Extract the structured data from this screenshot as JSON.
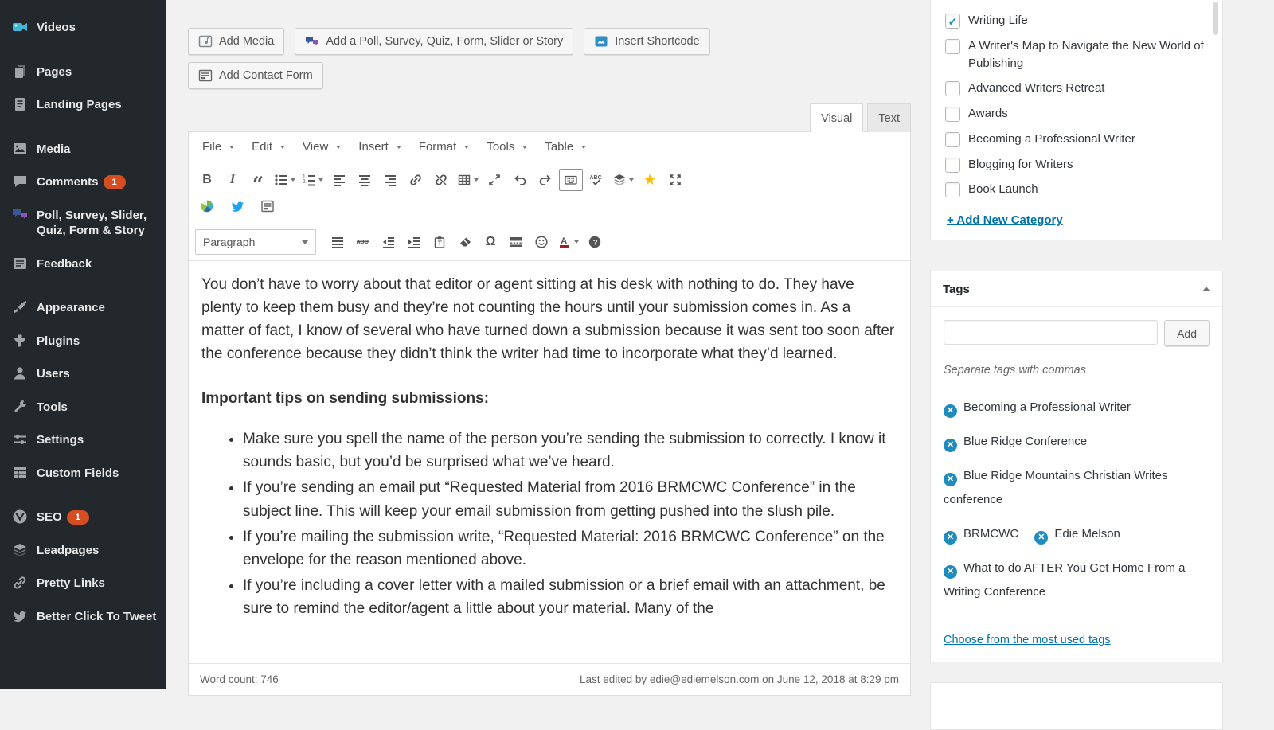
{
  "colors": {
    "accent": "#0073aa",
    "sidebar_bg": "#23282d",
    "badge": "#d54e21",
    "checkbox_check": "#1e8cbe",
    "tag_remove": "#1e8cbe",
    "star": "#ffb900",
    "twitter": "#1da1f2"
  },
  "sidebar": {
    "items": [
      {
        "label": "Videos"
      },
      {
        "label": "Pages"
      },
      {
        "label": "Landing Pages"
      },
      {
        "label": "Media"
      },
      {
        "label": "Comments",
        "badge": "1"
      },
      {
        "label": "Poll, Survey, Slider, Quiz, Form & Story"
      },
      {
        "label": "Feedback"
      },
      {
        "label": "Appearance"
      },
      {
        "label": "Plugins"
      },
      {
        "label": "Users"
      },
      {
        "label": "Tools"
      },
      {
        "label": "Settings"
      },
      {
        "label": "Custom Fields"
      },
      {
        "label": "SEO",
        "badge": "1"
      },
      {
        "label": "Leadpages"
      },
      {
        "label": "Pretty Links"
      },
      {
        "label": "Better Click To Tweet"
      }
    ]
  },
  "actions": {
    "add_media": "Add Media",
    "add_poll": "Add a Poll, Survey, Quiz, Form, Slider or Story",
    "insert_shortcode": "Insert Shortcode",
    "add_contact_form": "Add Contact Form"
  },
  "editor": {
    "tabs": {
      "visual": "Visual",
      "text": "Text"
    },
    "menus": [
      "File",
      "Edit",
      "View",
      "Insert",
      "Format",
      "Tools",
      "Table"
    ],
    "paragraph_dropdown": "Paragraph",
    "content": {
      "paragraph1": "You don’t have to worry about that editor or agent sitting at his desk with nothing to do. They have plenty to keep them busy and they’re not counting the hours until your submission comes in. As a matter of fact, I know of several who have turned down a submission because it was sent too soon after the conference because they didn’t think the writer had time to incorporate what they’d learned.",
      "heading": "Important tips on sending submissions:",
      "bullets": [
        "Make sure you spell the name of the person you’re sending the submission to correctly. I know it sounds basic, but you’d be surprised what we’ve heard.",
        "If you’re sending an email put “Requested Material from 2016 BRMCWC Conference” in the subject line. This will keep your email submission from getting pushed into the slush pile.",
        "If you’re mailing the submission write, “Requested Material: 2016 BRMCWC Conference” on the envelope for the reason mentioned above.",
        "If you’re including a cover letter with a mailed submission or a brief email with an attachment, be sure to remind the editor/agent a little about your material. Many of the"
      ]
    },
    "status": {
      "word_count": "Word count: 746",
      "last_edited": "Last edited by edie@ediemelson.com on June 12, 2018 at 8:29 pm"
    }
  },
  "categories": {
    "items": [
      {
        "label": "Writing Life",
        "checked": true
      },
      {
        "label": "A Writer's Map to Navigate the New World of Publishing",
        "checked": false
      },
      {
        "label": "Advanced Writers Retreat",
        "checked": false
      },
      {
        "label": "Awards",
        "checked": false
      },
      {
        "label": "Becoming a Professional Writer",
        "checked": false
      },
      {
        "label": "Blogging for Writers",
        "checked": false
      },
      {
        "label": "Book Launch",
        "checked": false
      }
    ],
    "add_new": "+ Add New Category"
  },
  "tags": {
    "title": "Tags",
    "add_button": "Add",
    "hint": "Separate tags with commas",
    "items": [
      "Becoming a Professional Writer",
      "Blue Ridge Conference",
      "Blue Ridge Mountains Christian Writes conference",
      "BRMCWC",
      "Edie Melson",
      "What to do AFTER You Get Home From a Writing Conference"
    ],
    "most_used": "Choose from the most used tags"
  }
}
